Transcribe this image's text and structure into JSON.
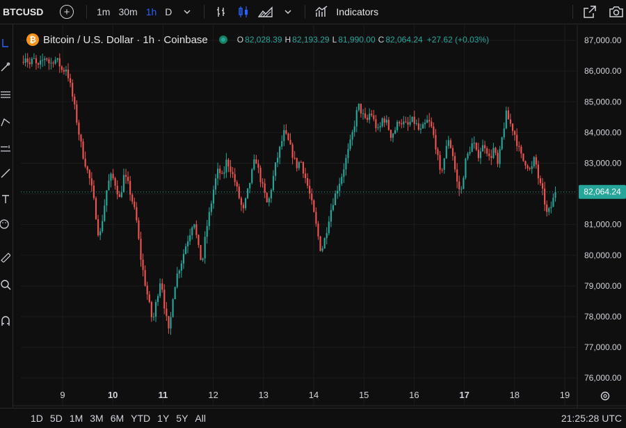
{
  "toolbar": {
    "symbol": "BTCUSD",
    "intervals": [
      {
        "label": "1m",
        "active": false
      },
      {
        "label": "30m",
        "active": false
      },
      {
        "label": "1h",
        "active": true
      },
      {
        "label": "D",
        "active": false
      }
    ],
    "indicators_label": "Indicators",
    "icons": [
      "add-symbol-icon",
      "chevron-down-icon",
      "bar-style-icon",
      "candles-icon",
      "area-icon",
      "chevron-down-icon",
      "indicators-icon",
      "snapshot-icon",
      "camera-icon"
    ]
  },
  "left_tools": [
    "crosshair-icon",
    "trend-line-icon",
    "fib-icon",
    "pattern-icon",
    "prediction-icon",
    "brush-icon",
    "text-icon",
    "emoji-icon",
    "ruler-icon",
    "zoom-icon",
    "magnet-icon"
  ],
  "legend": {
    "title": "Bitcoin / U.S. Dollar · 1h · Coinbase",
    "o_label": "O",
    "o": "82,028.39",
    "h_label": "H",
    "h": "82,193.29",
    "l_label": "L",
    "l": "81,990.00",
    "c_label": "C",
    "c": "82,064.24",
    "change": "+27.62 (+0.03%)"
  },
  "colors": {
    "up": "#26a69a",
    "down": "#ef5350",
    "accent": "#2962ff",
    "price_tag": "#26a69a"
  },
  "price_label": "82,064.24",
  "bottom": {
    "ranges": [
      "1D",
      "5D",
      "1M",
      "3M",
      "6M",
      "YTD",
      "1Y",
      "5Y",
      "All"
    ],
    "clock": "21:25:28 UTC"
  },
  "chart_data": {
    "type": "candlestick",
    "interval": "1h",
    "y_ticks": [
      "87,000.00",
      "86,000.00",
      "85,000.00",
      "84,000.00",
      "83,000.00",
      "82,000.00",
      "81,000.00",
      "80,000.00",
      "79,000.00",
      "78,000.00",
      "77,000.00",
      "76,000.00"
    ],
    "y_tick_values": [
      87000,
      86000,
      85000,
      84000,
      83000,
      82000,
      81000,
      80000,
      79000,
      78000,
      77000,
      76000
    ],
    "x_ticks": [
      "9",
      "10",
      "11",
      "12",
      "13",
      "14",
      "15",
      "16",
      "17",
      "18",
      "19"
    ],
    "x_tick_bold": [
      false,
      true,
      true,
      false,
      false,
      false,
      false,
      false,
      true,
      false,
      false
    ],
    "ylim": [
      75800,
      87500
    ],
    "last_price": 82064.24,
    "close_path": [
      [
        0,
        86300
      ],
      [
        1,
        86500
      ],
      [
        2,
        86200
      ],
      [
        3,
        86400
      ],
      [
        4,
        86100
      ],
      [
        5,
        86300
      ],
      [
        6,
        86500
      ],
      [
        7,
        86200
      ],
      [
        8,
        86400
      ],
      [
        9,
        86300
      ],
      [
        10,
        86000
      ],
      [
        11,
        86100
      ],
      [
        12,
        85500
      ],
      [
        13,
        84800
      ],
      [
        14,
        84000
      ],
      [
        15,
        83300
      ],
      [
        16,
        82800
      ],
      [
        17,
        82300
      ],
      [
        18,
        81500
      ],
      [
        19,
        80500
      ],
      [
        20,
        81400
      ],
      [
        21,
        82300
      ],
      [
        22,
        82600
      ],
      [
        23,
        82300
      ],
      [
        24,
        81800
      ],
      [
        25,
        82600
      ],
      [
        26,
        82300
      ],
      [
        27,
        81800
      ],
      [
        28,
        81200
      ],
      [
        29,
        80000
      ],
      [
        30,
        79200
      ],
      [
        31,
        78500
      ],
      [
        32,
        77800
      ],
      [
        33,
        78600
      ],
      [
        34,
        79300
      ],
      [
        35,
        78200
      ],
      [
        36,
        77400
      ],
      [
        37,
        78800
      ],
      [
        38,
        79400
      ],
      [
        39,
        79800
      ],
      [
        40,
        80300
      ],
      [
        41,
        80700
      ],
      [
        42,
        81200
      ],
      [
        43,
        80300
      ],
      [
        44,
        79700
      ],
      [
        45,
        80800
      ],
      [
        46,
        81500
      ],
      [
        47,
        82300
      ],
      [
        48,
        82800
      ],
      [
        49,
        82500
      ],
      [
        50,
        83100
      ],
      [
        51,
        82800
      ],
      [
        52,
        82400
      ],
      [
        53,
        81900
      ],
      [
        54,
        81400
      ],
      [
        55,
        82000
      ],
      [
        56,
        82600
      ],
      [
        57,
        83200
      ],
      [
        58,
        82600
      ],
      [
        59,
        82100
      ],
      [
        60,
        81600
      ],
      [
        61,
        82300
      ],
      [
        62,
        83000
      ],
      [
        63,
        83500
      ],
      [
        64,
        84000
      ],
      [
        65,
        83700
      ],
      [
        66,
        83300
      ],
      [
        67,
        82900
      ],
      [
        68,
        83100
      ],
      [
        69,
        82600
      ],
      [
        70,
        82100
      ],
      [
        71,
        81500
      ],
      [
        72,
        80800
      ],
      [
        73,
        80100
      ],
      [
        74,
        80600
      ],
      [
        75,
        81300
      ],
      [
        76,
        81800
      ],
      [
        77,
        82200
      ],
      [
        78,
        82600
      ],
      [
        79,
        83100
      ],
      [
        80,
        83600
      ],
      [
        81,
        84200
      ],
      [
        82,
        84900
      ],
      [
        83,
        84600
      ],
      [
        84,
        84300
      ],
      [
        85,
        84700
      ],
      [
        86,
        84300
      ],
      [
        87,
        84000
      ],
      [
        88,
        84500
      ],
      [
        89,
        84300
      ],
      [
        90,
        83900
      ],
      [
        91,
        84100
      ],
      [
        92,
        84400
      ],
      [
        93,
        84300
      ],
      [
        94,
        84200
      ],
      [
        95,
        84400
      ],
      [
        96,
        84300
      ],
      [
        97,
        84000
      ],
      [
        98,
        84200
      ],
      [
        99,
        84400
      ],
      [
        100,
        84100
      ],
      [
        101,
        83500
      ],
      [
        102,
        82600
      ],
      [
        103,
        83200
      ],
      [
        104,
        83800
      ],
      [
        105,
        83300
      ],
      [
        106,
        82400
      ],
      [
        107,
        82000
      ],
      [
        108,
        83000
      ],
      [
        109,
        83400
      ],
      [
        110,
        83700
      ],
      [
        111,
        83200
      ],
      [
        112,
        83500
      ],
      [
        113,
        83600
      ],
      [
        114,
        83100
      ],
      [
        115,
        83500
      ],
      [
        116,
        82900
      ],
      [
        117,
        83800
      ],
      [
        118,
        84600
      ],
      [
        119,
        84300
      ],
      [
        120,
        84000
      ],
      [
        121,
        83500
      ],
      [
        122,
        83100
      ],
      [
        123,
        83000
      ],
      [
        124,
        82700
      ],
      [
        125,
        83200
      ],
      [
        126,
        82400
      ],
      [
        127,
        82000
      ],
      [
        128,
        81300
      ],
      [
        129,
        81600
      ],
      [
        130,
        82064
      ]
    ]
  }
}
